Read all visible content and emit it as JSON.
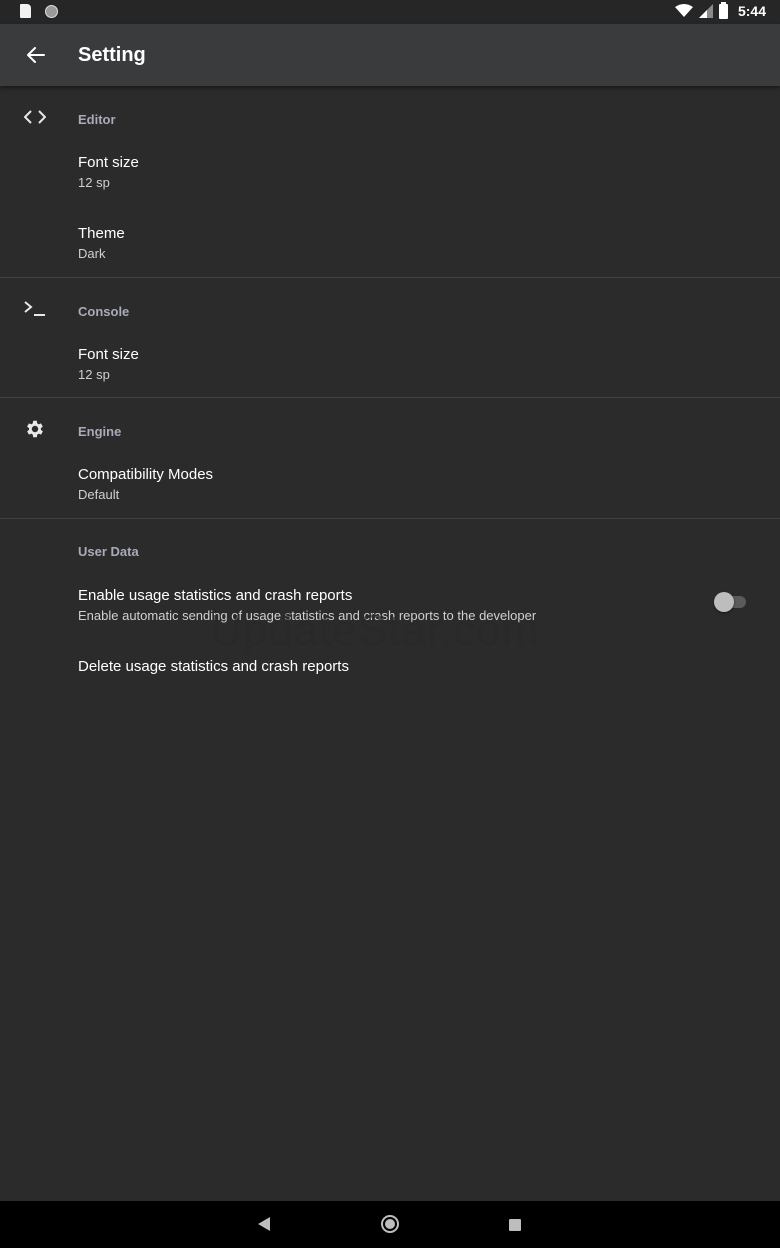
{
  "status_bar": {
    "time": "5:44"
  },
  "app_bar": {
    "title": "Setting"
  },
  "sections": {
    "editor": {
      "title": "Editor",
      "font_size": {
        "title": "Font size",
        "summary": "12 sp"
      },
      "theme": {
        "title": "Theme",
        "summary": "Dark"
      }
    },
    "console": {
      "title": "Console",
      "font_size": {
        "title": "Font size",
        "summary": "12 sp"
      }
    },
    "engine": {
      "title": "Engine",
      "compat": {
        "title": "Compatibility Modes",
        "summary": "Default"
      }
    },
    "user_data": {
      "title": "User Data",
      "usage": {
        "title": "Enable usage statistics and crash reports",
        "summary": "Enable automatic sending of usage statistics and crash reports to the developer",
        "enabled": false
      },
      "delete": {
        "title": "Delete usage statistics and crash reports"
      }
    }
  },
  "watermark": "UpdateStar.com",
  "icons": {
    "back": "arrow-back-icon",
    "editor": "code-icon",
    "console": "terminal-icon",
    "engine": "gear-icon"
  },
  "colors": {
    "background": "#2b2b2b",
    "app_bar": "#3a3b3d",
    "section_title": "#a9abb8",
    "divider": "#3f3f3f"
  }
}
